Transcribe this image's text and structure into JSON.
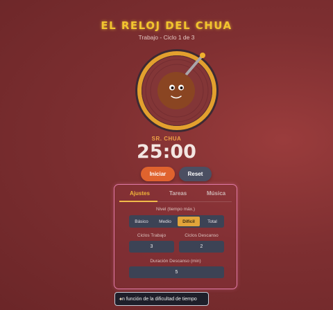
{
  "header": {
    "title": "EL RELOJ DEL CHUA",
    "subtitle": "Trabajo - Ciclo 1 de 3"
  },
  "timer": {
    "character_name": "SR. CHUA",
    "time": "25:00",
    "progress": 0.0
  },
  "controls": {
    "start_label": "Iniciar",
    "reset_label": "Reset"
  },
  "panel": {
    "tabs": [
      {
        "label": "Ajustes",
        "active": true
      },
      {
        "label": "Tareas",
        "active": false
      },
      {
        "label": "Música",
        "active": false
      }
    ],
    "level": {
      "label": "Nivel (tiempo máx.)",
      "options": [
        "Básico",
        "Medio",
        "Difícil",
        "Total"
      ],
      "selected": "Difícil"
    },
    "work_cycles": {
      "label": "Ciclos Trabajo",
      "value": "3"
    },
    "rest_cycles": {
      "label": "Ciclos Descanso",
      "value": "2"
    },
    "rest_duration": {
      "label": "Duración Descanso (min)",
      "value": "5"
    }
  },
  "tooltip": {
    "icon": "wand-icon",
    "text": "n función de la dificultad de tiempo"
  },
  "colors": {
    "accent": "#f2c52e",
    "ring": "#e3a02e",
    "start": "#e0632e",
    "reset": "#4b4f62",
    "panel_border": "#e07aa6"
  }
}
